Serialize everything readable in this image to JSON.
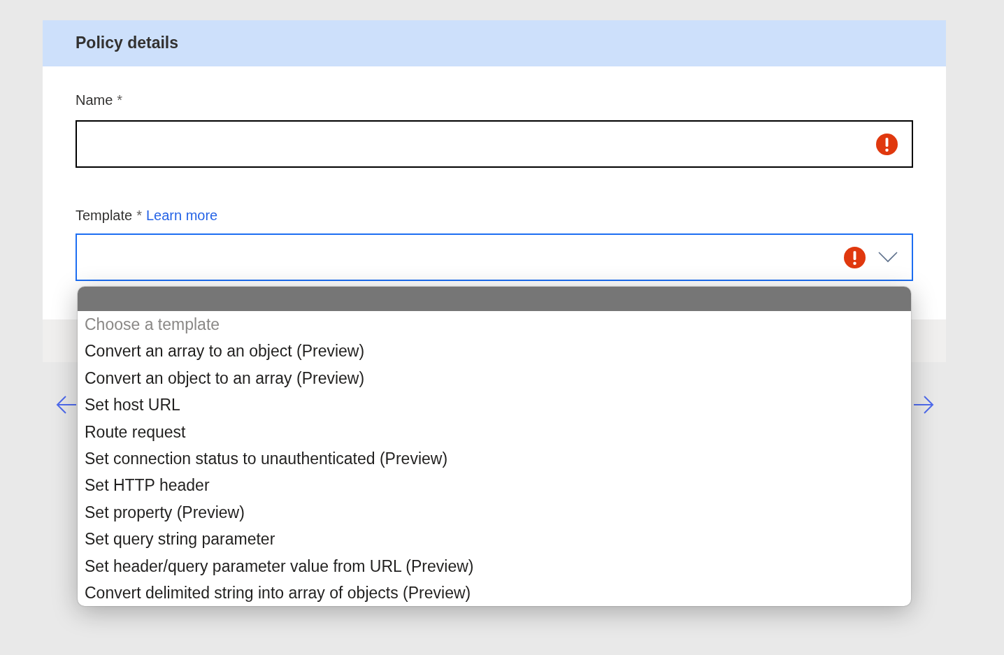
{
  "panel": {
    "title": "Policy details"
  },
  "fields": [
    {
      "kind": "text",
      "label": "Name",
      "required_mark": "*",
      "error": true,
      "focused": false
    },
    {
      "kind": "select",
      "label": "Template",
      "required_mark": "*",
      "link": "Learn more",
      "error": true,
      "focused": true,
      "expanded": true,
      "options": [
        {
          "label": "Choose a template",
          "disabled": true
        },
        {
          "label": "Convert an array to an object (Preview)",
          "disabled": false
        },
        {
          "label": "Convert an object to an array (Preview)",
          "disabled": false
        },
        {
          "label": "Set host URL",
          "disabled": false
        },
        {
          "label": "Route request",
          "disabled": false
        },
        {
          "label": "Set connection status to unauthenticated (Preview)",
          "disabled": false
        },
        {
          "label": "Set HTTP header",
          "disabled": false
        },
        {
          "label": "Set property (Preview)",
          "disabled": false
        },
        {
          "label": "Set query string parameter",
          "disabled": false
        },
        {
          "label": "Set header/query parameter value from URL (Preview)",
          "disabled": false
        },
        {
          "label": "Convert delimited string into array of objects (Preview)",
          "disabled": false
        }
      ]
    }
  ]
}
